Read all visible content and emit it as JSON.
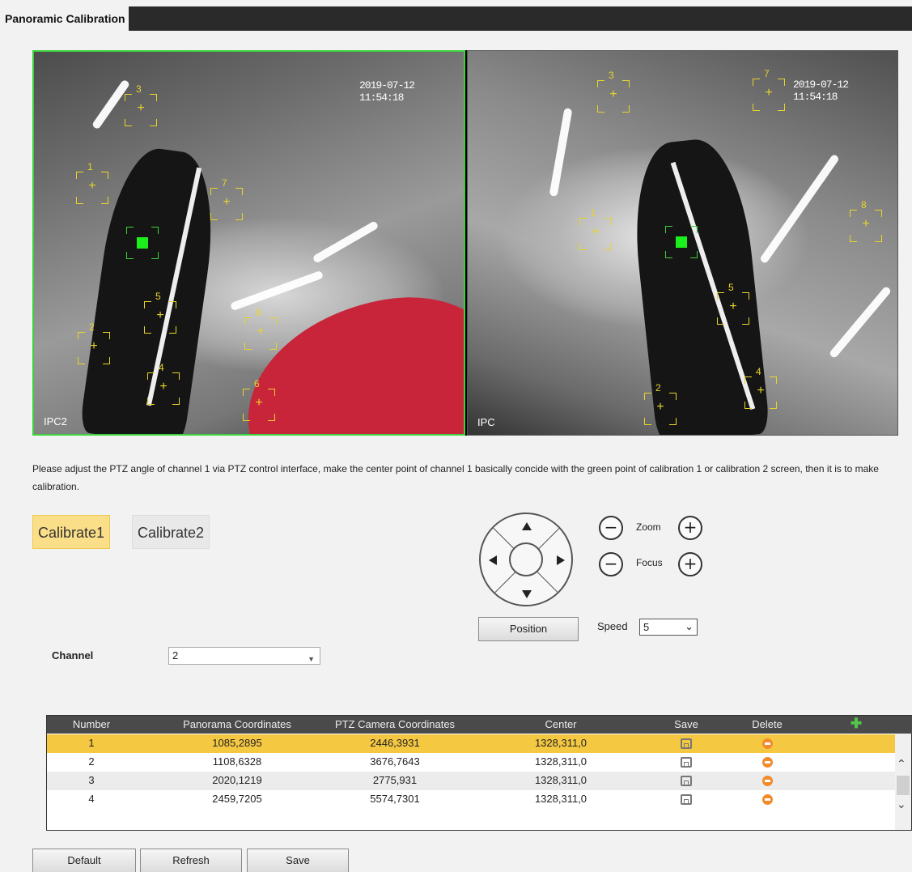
{
  "title": "Panoramic Calibration",
  "video": {
    "left": {
      "timestamp": "2019-07-12 11:54:18",
      "label": "IPC2",
      "markers": [
        "3",
        "1",
        "7",
        "5",
        "2",
        "8",
        "4",
        "6"
      ]
    },
    "right": {
      "timestamp": "2019-07-12 11:54:18",
      "label": "IPC",
      "markers": [
        "3",
        "7",
        "1",
        "8",
        "5",
        "2",
        "4"
      ]
    }
  },
  "instruction": "Please adjust the PTZ angle of channel 1 via PTZ control interface, make the center point of channel 1 basically concide with the green point of calibration 1 or calibration 2 screen, then it is to make calibration.",
  "tabs": [
    {
      "label": "Calibrate1",
      "active": true
    },
    {
      "label": "Calibrate2",
      "active": false
    }
  ],
  "ptz": {
    "zoom_label": "Zoom",
    "focus_label": "Focus",
    "minus": "−",
    "plus": "+",
    "position_button": "Position",
    "speed_label": "Speed",
    "speed_value": "5"
  },
  "channel": {
    "label": "Channel",
    "value": "2"
  },
  "table": {
    "headers": [
      "Number",
      "Panorama Coordinates",
      "PTZ Camera Coordinates",
      "Center",
      "Save",
      "Delete"
    ],
    "rows": [
      {
        "number": "1",
        "panorama": "1085,2895",
        "ptz": "2446,3931",
        "center": "1328,311,0"
      },
      {
        "number": "2",
        "panorama": "1108,6328",
        "ptz": "3676,7643",
        "center": "1328,311,0"
      },
      {
        "number": "3",
        "panorama": "2020,1219",
        "ptz": "2775,931",
        "center": "1328,311,0"
      },
      {
        "number": "4",
        "panorama": "2459,7205",
        "ptz": "5574,7301",
        "center": "1328,311,0"
      }
    ]
  },
  "buttons": {
    "default": "Default",
    "refresh": "Refresh",
    "save": "Save"
  },
  "icons": {
    "save": "save-icon",
    "delete": "delete-icon",
    "add": "add-icon"
  },
  "colors": {
    "selected_row": "#f5c842",
    "active_tab": "#fbdf88",
    "marker": "#e8d42a",
    "green_point": "#1cf01c"
  }
}
